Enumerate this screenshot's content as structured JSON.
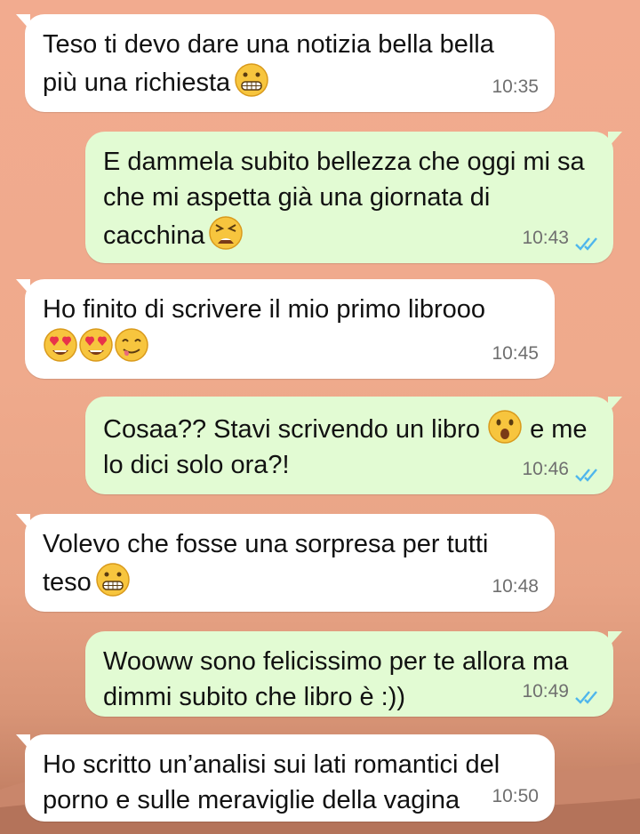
{
  "messages": [
    {
      "text": "Teso ti devo dare una notizia bella bella\npiù una richiesta",
      "time": "10:35"
    },
    {
      "text": "E dammela subito bellezza che oggi mi sa\nche mi aspetta già una giornata di\ncacchina",
      "time": "10:43",
      "status": "read-ticks-icon"
    },
    {
      "text": "Ho finito di scrivere il mio primo librooo",
      "time": "10:45"
    },
    {
      "text_a": "Cosaa?? Stavi scrivendo un libro",
      "text_b": "e me",
      "text_c": "lo dici solo ora?!",
      "time": "10:46",
      "status": "read-ticks-icon"
    },
    {
      "text": "Volevo che fosse una sorpresa per tutti\nteso",
      "time": "10:48"
    },
    {
      "text": "Wooww sono felicissimo per te allora ma\ndimmi subito che libro è :))",
      "time": "10:49",
      "status": "read-ticks-icon"
    },
    {
      "text": "Ho scritto un’analisi sui lati romantici del\nporno e sulle meraviglie della vagina",
      "time": "10:50"
    }
  ],
  "colors": {
    "incoming_bubble": "#ffffff",
    "outgoing_bubble": "#e2fbd3",
    "read_ticks": "#4fb6ec"
  }
}
